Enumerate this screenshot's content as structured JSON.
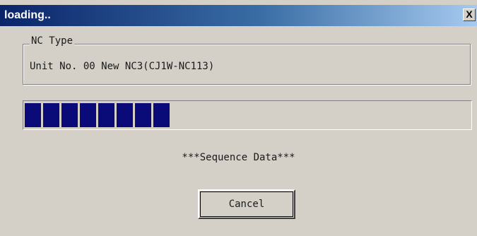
{
  "window": {
    "title": "loading..",
    "close_label": "X"
  },
  "group": {
    "legend": "NC Type",
    "content": "Unit No. 00 New NC3(CJ1W-NC113)"
  },
  "progress": {
    "filled_segments": 8,
    "fraction": 0.32,
    "color": "#0a0a78"
  },
  "status": "***Sequence Data***",
  "buttons": {
    "cancel": "Cancel"
  },
  "colors": {
    "titlebar_start": "#0a246a",
    "window_bg": "#d4d0c8"
  }
}
